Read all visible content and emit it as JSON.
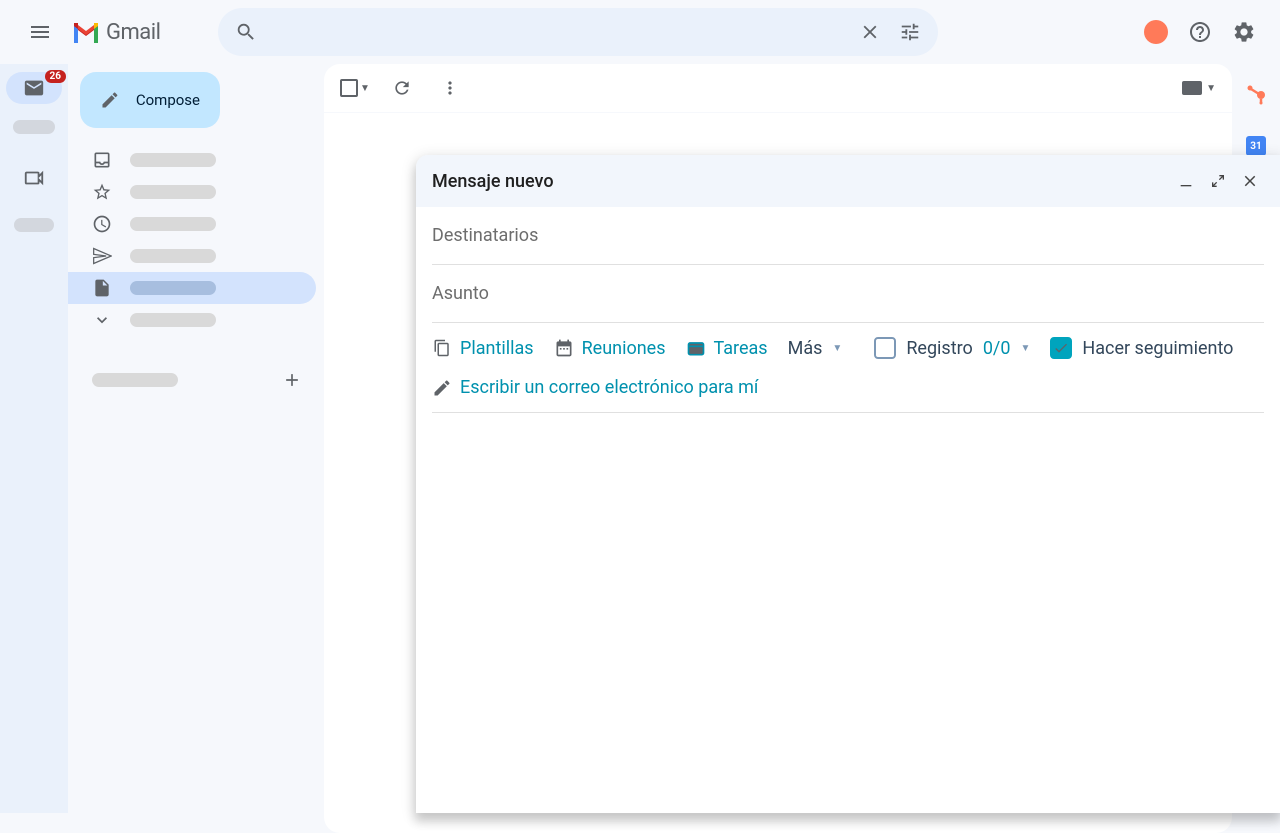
{
  "header": {
    "app_name": "Gmail",
    "badge_count": "26"
  },
  "sidebar": {
    "compose_label": "Compose"
  },
  "compose": {
    "title": "Mensaje nuevo",
    "recipients_placeholder": "Destinatarios",
    "subject_placeholder": "Asunto"
  },
  "hubspot": {
    "templates": "Plantillas",
    "meetings": "Reuniones",
    "tasks": "Tareas",
    "more": "Más",
    "log": "Registro",
    "log_count": "0/0",
    "track": "Hacer seguimiento",
    "write_email": "Escribir un correo electrónico para mí"
  },
  "calendar_day": "31"
}
